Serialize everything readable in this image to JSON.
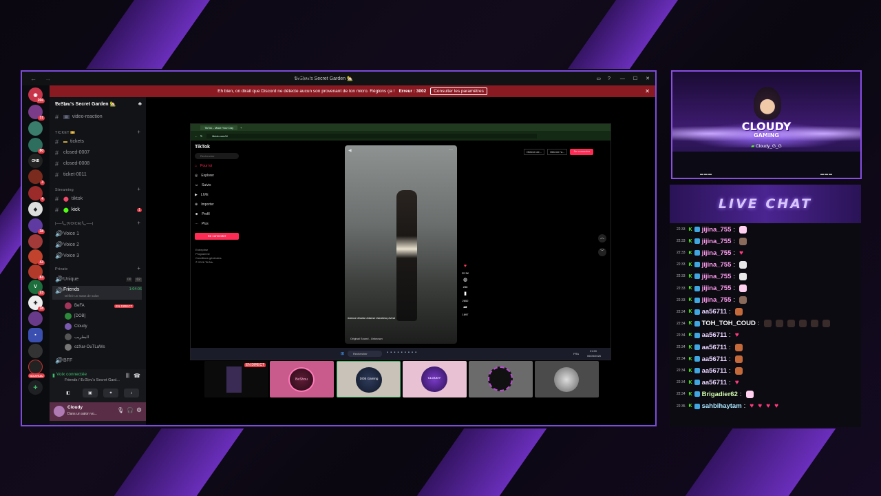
{
  "window": {
    "title": "𝔅𝔢𝔖𝔥𝔬𝔲's Secret Garden 🏡"
  },
  "banner": {
    "text": "Eh bien, on dirait que Discord ne détecte aucun son provenant de ton micro. Réglons ça !",
    "error": "Erreur : 3002",
    "button": "Consulter les paramètres"
  },
  "servers": {
    "badges": [
      "266",
      "31",
      "80",
      "3",
      "4",
      "38",
      "43",
      "83",
      "23",
      "18",
      "NOUVEAU"
    ]
  },
  "server": {
    "name": "𝔅𝔢𝔖𝔥𝔬𝔲's Secret Garden 🏡"
  },
  "channels": {
    "video_reaction": "video-reaction",
    "cat_ticket": "TICKET 🎫",
    "tickets": "tickets",
    "closed7": "closed-0007",
    "closed8": "closed-0008",
    "ticket11": "ticket-0011",
    "cat_streaming": "Streaming",
    "tiktok": "tiktok",
    "kick": "kick",
    "kick_badge": "1",
    "cat_voice": "|──📞[VOICE]📞──|",
    "voice1": "Voice 1",
    "voice2": "Voice 2",
    "voice3": "Voice 3",
    "cat_private": "Private",
    "unique": "Unique",
    "unique_count": "00",
    "unique_max": "02",
    "friends": "Friends",
    "friends_timer": "1:04:06",
    "friends_status": "Définir un statut de salon",
    "users": [
      "BeFA",
      "[DOB]",
      "Cloudy",
      "البطريب",
      "ozXar-OuTLaWs"
    ],
    "live_label": "EN DIRECT",
    "bff": "BFF"
  },
  "voice": {
    "status": "Voix connectée",
    "where": "Friends / 𝔅𝔢𝔖𝔥𝔬𝔲's Secret Gard..."
  },
  "user": {
    "name": "Cloudy",
    "status": "Dans un salon vo..."
  },
  "tiktok": {
    "tab": "TikTok - Make Your Day",
    "url": "tiktok.com/fr/",
    "logo": "TikTok",
    "search": "Rechercher",
    "nav": [
      "Pour toi",
      "Explorer",
      "Suivis",
      "LIVE",
      "Importer",
      "Profil",
      "Plus"
    ],
    "login": "Se connecter",
    "footer": [
      "Entreprise",
      "Programme",
      "Conditions générales",
      "© 2026 TikTok"
    ],
    "get_app": "Obtenir de...",
    "get_pc": "Obtenir l'a...",
    "login_top": "Se connecter",
    "hashtags": "#dance #bailar #danse #arabesq #viral",
    "sound": "Original Sound - Unknown",
    "counts": [
      "22.3K",
      "286",
      "2652",
      "1697"
    ],
    "taskbar_search": "Rechercher",
    "clock": "21:59",
    "date": "06/05/2026",
    "lang": "FRA"
  },
  "thumbs": {
    "live": "EN DIRECT",
    "labels": [
      "BeShou",
      "DOB Gaming",
      "CLOUDY GAMING"
    ]
  },
  "cam": {
    "logo1": "CLOUDY",
    "logo2": "GAMING",
    "handle": "Cloudy_G_G"
  },
  "chat": {
    "title": "LIVE CHAT",
    "messages": [
      {
        "time": "22:33",
        "name": "jijina_755",
        "color": "#ff9cf0",
        "emote": "hand"
      },
      {
        "time": "22:33",
        "name": "jijina_755",
        "color": "#ff9cf0",
        "emote": "figure"
      },
      {
        "time": "22:33",
        "name": "jijina_755",
        "color": "#ff9cf0",
        "emote": "heart"
      },
      {
        "time": "22:33",
        "name": "jijina_755",
        "color": "#ff9cf0",
        "emote": "paw"
      },
      {
        "time": "22:33",
        "name": "jijina_755",
        "color": "#ff9cf0",
        "emote": "paw"
      },
      {
        "time": "22:33",
        "name": "jijina_755",
        "color": "#ff9cf0",
        "emote": "hand"
      },
      {
        "time": "22:33",
        "name": "jijina_755",
        "color": "#ff9cf0",
        "emote": "figure"
      },
      {
        "time": "22:34",
        "name": "aa56711",
        "color": "#e7d4ff",
        "emote": "face"
      },
      {
        "time": "22:34",
        "name": "TOH_TOH_COUD",
        "color": "#ffffff",
        "emote": "hats"
      },
      {
        "time": "22:34",
        "name": "aa56711",
        "color": "#e7d4ff",
        "emote": "heart"
      },
      {
        "time": "22:34",
        "name": "aa56711",
        "color": "#e7d4ff",
        "emote": "face"
      },
      {
        "time": "22:34",
        "name": "aa56711",
        "color": "#e7d4ff",
        "emote": "face"
      },
      {
        "time": "22:34",
        "name": "aa56711",
        "color": "#e7d4ff",
        "emote": "face"
      },
      {
        "time": "22:34",
        "name": "aa56711",
        "color": "#e7d4ff",
        "emote": "heart"
      },
      {
        "time": "22:34",
        "name": "Brigadier62",
        "color": "#d4ffb0",
        "emote": "hand"
      },
      {
        "time": "22:35",
        "name": "sahbihaytam",
        "color": "#a9e6ff",
        "emote": "hearts"
      }
    ]
  }
}
